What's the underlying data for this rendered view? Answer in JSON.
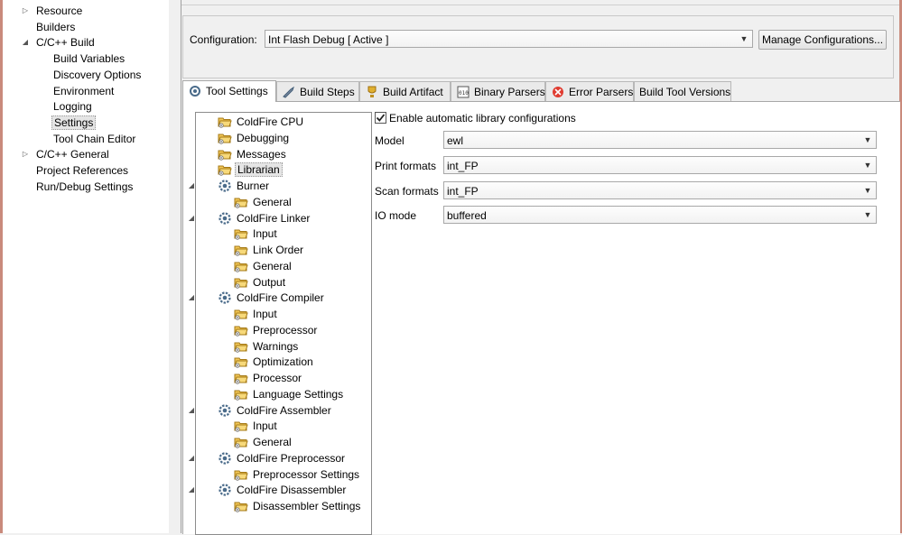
{
  "left_tree": {
    "items": [
      {
        "label": "Resource",
        "expander": "collapsed"
      },
      {
        "label": "Builders",
        "expander": ""
      },
      {
        "label": "C/C++ Build",
        "expander": "expanded"
      },
      {
        "label": "Build Variables",
        "expander": ""
      },
      {
        "label": "Discovery Options",
        "expander": ""
      },
      {
        "label": "Environment",
        "expander": ""
      },
      {
        "label": "Logging",
        "expander": ""
      },
      {
        "label": "Settings",
        "expander": "",
        "selected": true
      },
      {
        "label": "Tool Chain Editor",
        "expander": ""
      },
      {
        "label": "C/C++ General",
        "expander": "collapsed"
      },
      {
        "label": "Project References",
        "expander": ""
      },
      {
        "label": "Run/Debug Settings",
        "expander": ""
      }
    ]
  },
  "configuration": {
    "label": "Configuration:",
    "value": "Int Flash Debug  [ Active ]",
    "manage_button": "Manage Configurations..."
  },
  "tabs": [
    {
      "label": "Tool Settings",
      "icon": "tool-settings-icon",
      "active": true
    },
    {
      "label": "Build Steps",
      "icon": "build-steps-icon"
    },
    {
      "label": "Build Artifact",
      "icon": "build-artifact-icon"
    },
    {
      "label": "Binary Parsers",
      "icon": "binary-parsers-icon"
    },
    {
      "label": "Error Parsers",
      "icon": "error-parsers-icon"
    },
    {
      "label": "Build Tool Versions",
      "icon": ""
    }
  ],
  "tool_tree": {
    "nodes": [
      {
        "label": "ColdFire CPU",
        "type": "option",
        "level": 0
      },
      {
        "label": "Debugging",
        "type": "option",
        "level": 0
      },
      {
        "label": "Messages",
        "type": "option",
        "level": 0
      },
      {
        "label": "Librarian",
        "type": "option",
        "level": 0,
        "selected": true
      },
      {
        "label": "Burner",
        "type": "tool",
        "level": 0
      },
      {
        "label": "General",
        "type": "option",
        "level": 1
      },
      {
        "label": "ColdFire Linker",
        "type": "tool",
        "level": 0
      },
      {
        "label": "Input",
        "type": "option",
        "level": 1
      },
      {
        "label": "Link Order",
        "type": "option",
        "level": 1
      },
      {
        "label": "General",
        "type": "option",
        "level": 1
      },
      {
        "label": "Output",
        "type": "option",
        "level": 1
      },
      {
        "label": "ColdFire Compiler",
        "type": "tool",
        "level": 0
      },
      {
        "label": "Input",
        "type": "option",
        "level": 1
      },
      {
        "label": "Preprocessor",
        "type": "option",
        "level": 1
      },
      {
        "label": "Warnings",
        "type": "option",
        "level": 1
      },
      {
        "label": "Optimization",
        "type": "option",
        "level": 1
      },
      {
        "label": "Processor",
        "type": "option",
        "level": 1
      },
      {
        "label": "Language Settings",
        "type": "option",
        "level": 1
      },
      {
        "label": "ColdFire Assembler",
        "type": "tool",
        "level": 0
      },
      {
        "label": "Input",
        "type": "option",
        "level": 1
      },
      {
        "label": "General",
        "type": "option",
        "level": 1
      },
      {
        "label": "ColdFire Preprocessor",
        "type": "tool",
        "level": 0
      },
      {
        "label": "Preprocessor Settings",
        "type": "option",
        "level": 1
      },
      {
        "label": "ColdFire Disassembler",
        "type": "tool",
        "level": 0
      },
      {
        "label": "Disassembler Settings",
        "type": "option",
        "level": 1
      }
    ]
  },
  "librarian": {
    "enable_auto": {
      "label": "Enable automatic library configurations",
      "checked": true
    },
    "model": {
      "label": "Model",
      "value": "ewl"
    },
    "print_formats": {
      "label": "Print formats",
      "value": "int_FP"
    },
    "scan_formats": {
      "label": "Scan formats",
      "value": "int_FP"
    },
    "io_mode": {
      "label": "IO mode",
      "value": "buffered"
    }
  },
  "colors": {
    "frame": "#c98a7c",
    "selection": "#e5e5e5",
    "tool_icon": "#4a6b8a",
    "folder": "#e8b84a"
  }
}
